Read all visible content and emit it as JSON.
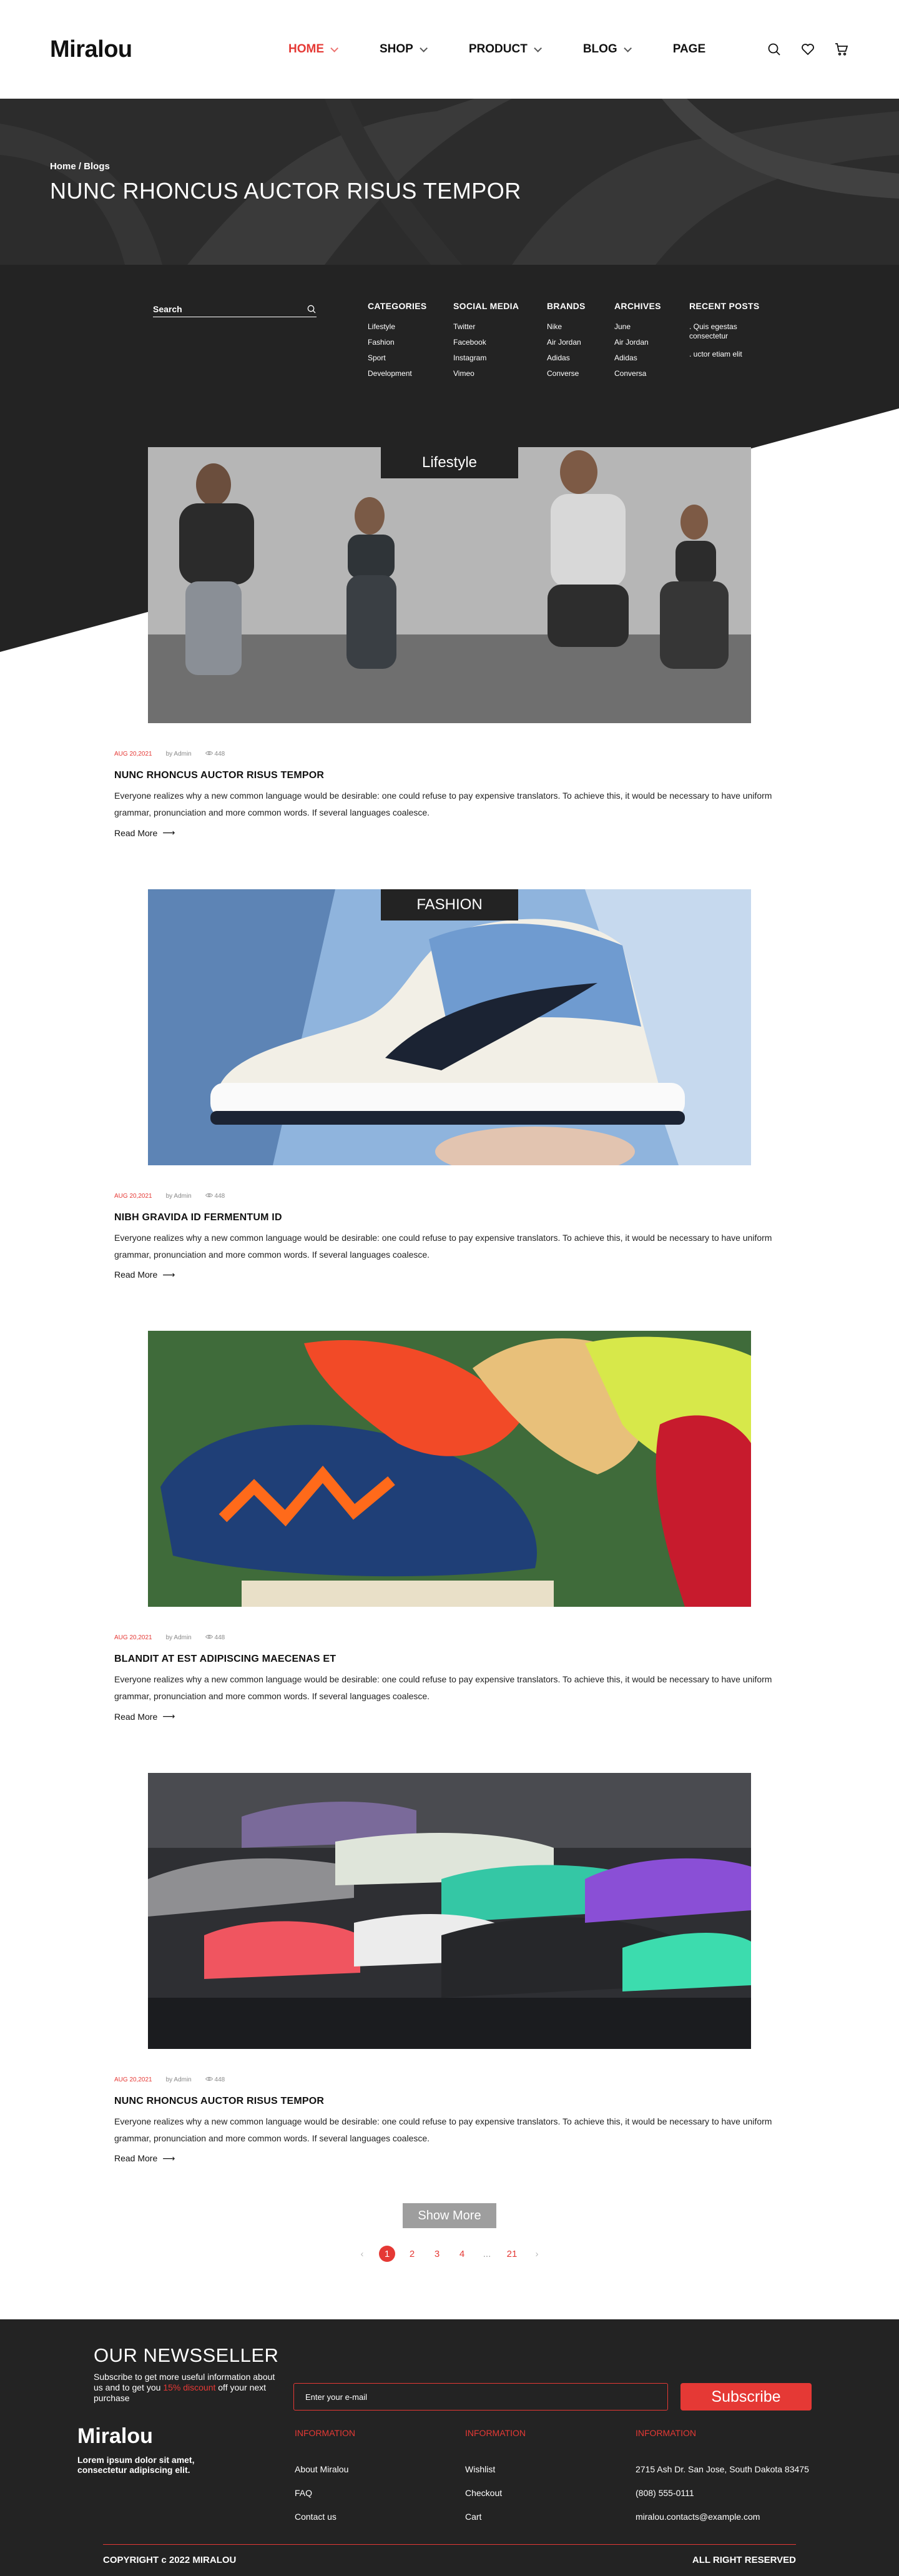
{
  "header": {
    "logo": "Miralou",
    "nav": [
      {
        "label": "HOME",
        "active": true,
        "dropdown": true
      },
      {
        "label": "SHOP",
        "active": false,
        "dropdown": true
      },
      {
        "label": "PRODUCT",
        "active": false,
        "dropdown": true
      },
      {
        "label": "BLOG",
        "active": false,
        "dropdown": true
      },
      {
        "label": "PAGE",
        "active": false,
        "dropdown": false
      }
    ],
    "icons": [
      "search-icon",
      "heart-icon",
      "cart-icon"
    ]
  },
  "hero": {
    "breadcrumb": "Home / Blogs",
    "title": "NUNC RHONCUS AUCTOR RISUS TEMPOR"
  },
  "filters": {
    "search_placeholder": "Search",
    "columns": [
      {
        "title": "CATEGORIES",
        "items": [
          "Lifestyle",
          "Fashion",
          "Sport",
          "Development"
        ]
      },
      {
        "title": "SOCIAL MEDIA",
        "items": [
          "Twitter",
          "Facebook",
          "Instagram",
          "Vimeo"
        ]
      },
      {
        "title": "BRANDS",
        "items": [
          "Nike",
          "Air Jordan",
          "Adidas",
          "Converse"
        ]
      },
      {
        "title": "ARCHIVES",
        "items": [
          "June",
          "Air Jordan",
          "Adidas",
          "Conversa"
        ]
      },
      {
        "title": "RECENT POSTS",
        "items": [
          ". Quis egestas consectetur",
          ". uctor etiam elit"
        ]
      }
    ]
  },
  "posts": [
    {
      "tag": "Lifestyle",
      "date": "AUG 20,2021",
      "author": "by Admin",
      "views": "448",
      "title": "NUNC RHONCUS AUCTOR RISUS TEMPOR",
      "excerpt": "Everyone realizes why a new common language would be desirable: one could refuse to pay expensive translators. To achieve this, it would be necessary to have uniform grammar, pronunciation and more common words. If several languages coalesce.",
      "read_more": "Read More"
    },
    {
      "tag": "FASHION",
      "date": "AUG 20,2021",
      "author": "by Admin",
      "views": "448",
      "title": "NIBH GRAVIDA ID FERMENTUM ID",
      "excerpt": "Everyone realizes why a new common language would be desirable: one could refuse to pay expensive translators. To achieve this, it would be necessary to have uniform grammar, pronunciation and more common words. If several languages coalesce.",
      "read_more": "Read More"
    },
    {
      "tag": "",
      "date": "AUG 20,2021",
      "author": "by Admin",
      "views": "448",
      "title": "BLANDIT AT EST ADIPISCING MAECENAS ET",
      "excerpt": "Everyone realizes why a new common language would be desirable: one could refuse to pay expensive translators. To achieve this, it would be necessary to have uniform grammar, pronunciation and more common words. If several languages coalesce.",
      "read_more": "Read More"
    },
    {
      "tag": "",
      "date": "AUG 20,2021",
      "author": "by Admin",
      "views": "448",
      "title": "NUNC RHONCUS AUCTOR RISUS TEMPOR",
      "excerpt": "Everyone realizes why a new common language would be desirable: one could refuse to pay expensive translators. To achieve this, it would be necessary to have uniform grammar, pronunciation and more common words. If several languages coalesce.",
      "read_more": "Read More"
    }
  ],
  "show_more": "Show More",
  "pagination": {
    "pages": [
      "1",
      "2",
      "3",
      "4",
      "...",
      "21"
    ],
    "current": "1"
  },
  "footer": {
    "newsletter_title": "OUR NEWSSELLER",
    "newsletter_text_before": "Subscribe to get more useful information about us and to get you ",
    "newsletter_highlight": "15% discount",
    "newsletter_text_after": " off your next purchase",
    "email_placeholder": "Enter your e-mail",
    "subscribe": "Subscribe",
    "brand": "Miralou",
    "brand_text": "Lorem ipsum dolor sit amet, consectetur adipiscing elit.",
    "columns": [
      {
        "title": "INFORMATION",
        "items": [
          "About Miralou",
          "FAQ",
          "Contact us"
        ]
      },
      {
        "title": "INFORMATION",
        "items": [
          "Wishlist",
          "Checkout",
          "Cart"
        ]
      },
      {
        "title": "INFORMATION",
        "items": [
          "2715 Ash Dr. San Jose, South Dakota 83475",
          "(808) 555-0111",
          "miralou.contacts@example.com"
        ]
      }
    ],
    "copyright": "COPYRIGHT c 2022 MIRALOU",
    "rights": "ALL RIGHT RESERVED"
  },
  "colors": {
    "accent": "#e53935",
    "dark": "#232323"
  }
}
